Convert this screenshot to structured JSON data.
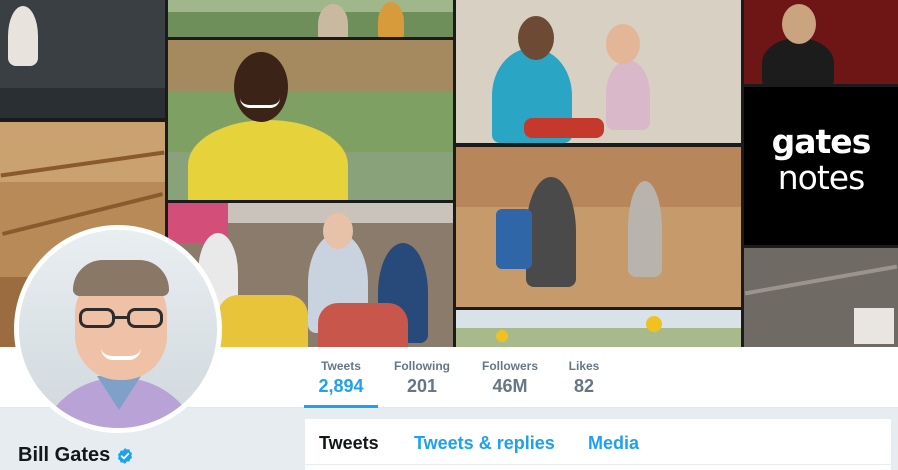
{
  "profile": {
    "name": "Bill Gates",
    "verified": true,
    "accent_color": "#1da1f2"
  },
  "header": {
    "logo_line1": "gates",
    "logo_line2": "notes"
  },
  "stats": [
    {
      "label": "Tweets",
      "value": "2,894",
      "active": true
    },
    {
      "label": "Following",
      "value": "201",
      "active": false
    },
    {
      "label": "Followers",
      "value": "46M",
      "active": false
    },
    {
      "label": "Likes",
      "value": "82",
      "active": false
    }
  ],
  "tabs": [
    {
      "label": "Tweets",
      "active": true
    },
    {
      "label": "Tweets & replies",
      "active": false
    },
    {
      "label": "Media",
      "active": false
    }
  ],
  "icons": {
    "verified": "verified-badge-icon"
  }
}
